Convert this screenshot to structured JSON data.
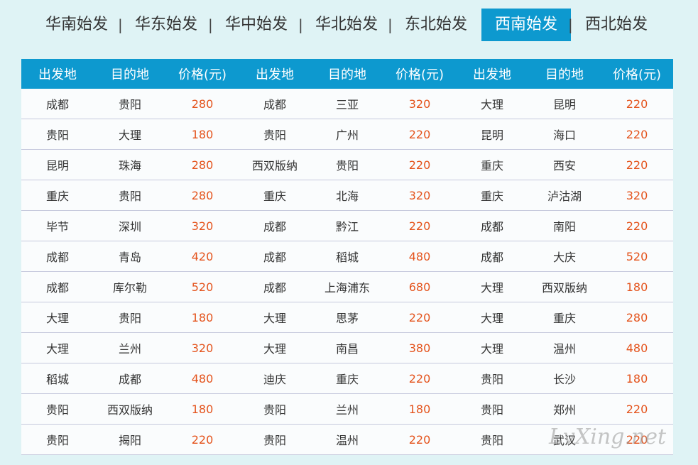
{
  "tabs": [
    {
      "label": "华南始发",
      "active": false
    },
    {
      "label": "华东始发",
      "active": false
    },
    {
      "label": "华中始发",
      "active": false
    },
    {
      "label": "华北始发",
      "active": false
    },
    {
      "label": "东北始发",
      "active": false
    },
    {
      "label": "西南始发",
      "active": true
    },
    {
      "label": "西北始发",
      "active": false
    }
  ],
  "separator": "|",
  "table": {
    "headers": [
      "出发地",
      "目的地",
      "价格(元)",
      "出发地",
      "目的地",
      "价格(元)",
      "出发地",
      "目的地",
      "价格(元)"
    ],
    "rows": [
      [
        "成都",
        "贵阳",
        "280",
        "成都",
        "三亚",
        "320",
        "大理",
        "昆明",
        "220"
      ],
      [
        "贵阳",
        "大理",
        "180",
        "贵阳",
        "广州",
        "220",
        "昆明",
        "海口",
        "220"
      ],
      [
        "昆明",
        "珠海",
        "280",
        "西双版纳",
        "贵阳",
        "220",
        "重庆",
        "西安",
        "220"
      ],
      [
        "重庆",
        "贵阳",
        "280",
        "重庆",
        "北海",
        "320",
        "重庆",
        "泸沽湖",
        "320"
      ],
      [
        "毕节",
        "深圳",
        "320",
        "成都",
        "黔江",
        "220",
        "成都",
        "南阳",
        "220"
      ],
      [
        "成都",
        "青岛",
        "420",
        "成都",
        "稻城",
        "480",
        "成都",
        "大庆",
        "520"
      ],
      [
        "成都",
        "库尔勒",
        "520",
        "成都",
        "上海浦东",
        "680",
        "大理",
        "西双版纳",
        "180"
      ],
      [
        "大理",
        "贵阳",
        "180",
        "大理",
        "思茅",
        "220",
        "大理",
        "重庆",
        "280"
      ],
      [
        "大理",
        "兰州",
        "320",
        "大理",
        "南昌",
        "380",
        "大理",
        "温州",
        "480"
      ],
      [
        "稻城",
        "成都",
        "480",
        "迪庆",
        "重庆",
        "220",
        "贵阳",
        "长沙",
        "180"
      ],
      [
        "贵阳",
        "西双版纳",
        "180",
        "贵阳",
        "兰州",
        "180",
        "贵阳",
        "郑州",
        "220"
      ],
      [
        "贵阳",
        "揭阳",
        "220",
        "贵阳",
        "温州",
        "220",
        "贵阳",
        "武汉",
        "220"
      ]
    ]
  },
  "watermark": "LvXing.net",
  "colors": {
    "accent": "#0d99cf",
    "price": "#e4531c",
    "background": "#dff3f5"
  }
}
